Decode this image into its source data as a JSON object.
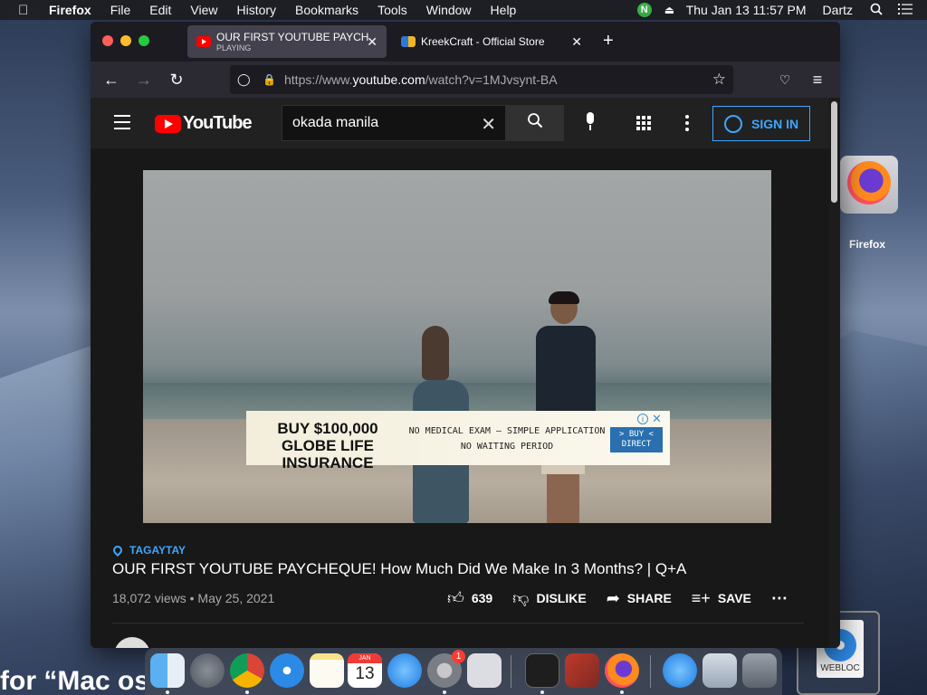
{
  "menubar": {
    "app": "Firefox",
    "items": [
      "File",
      "Edit",
      "View",
      "History",
      "Bookmarks",
      "Tools",
      "Window",
      "Help"
    ],
    "clock": "Thu Jan 13  11:57 PM",
    "user": "Dartz",
    "status_icon_letter": "N"
  },
  "browser": {
    "tabs": [
      {
        "title": "OUR FIRST YOUTUBE PAYCHEQUE! How Much Did We Make",
        "subtitle": "PLAYING",
        "favicon": "youtube-favicon"
      },
      {
        "title": "KreekCraft - Official Store",
        "subtitle": "",
        "favicon": "kreekcraft-favicon"
      }
    ],
    "url_prefix": "https://www.",
    "url_host": "youtube.com",
    "url_path": "/watch?v=1MJvsynt-BA",
    "accent": "#42414d"
  },
  "youtube": {
    "logo_text": "YouTube",
    "search_value": "okada manila",
    "signin_label": "SIGN IN",
    "brand_red": "#ff0000",
    "accent_blue": "#3ea6ff",
    "ad": {
      "headline_1": "BUY $100,000",
      "headline_2": "GLOBE LIFE INSURANCE",
      "line_1": "NO MEDICAL EXAM – SIMPLE APPLICATION",
      "line_2": "NO WAITING PERIOD",
      "cta": "> BUY < DIRECT"
    },
    "video": {
      "location": "TAGAYTAY",
      "title": "OUR FIRST YOUTUBE PAYCHEQUE! How Much Did We Make In 3 Months? | Q+A",
      "views": "18,072 views",
      "date": "May 25, 2021",
      "likes": "639",
      "dislike_label": "DISLIKE",
      "share_label": "SHARE",
      "save_label": "SAVE"
    }
  },
  "desktop": {
    "firefox_label": "Firefox",
    "webloc_label": "WEBLOC",
    "search_fragment": "for “Mac os"
  },
  "dock": {
    "calendar_month": "JAN",
    "calendar_day": "13",
    "settings_badge": "1"
  }
}
